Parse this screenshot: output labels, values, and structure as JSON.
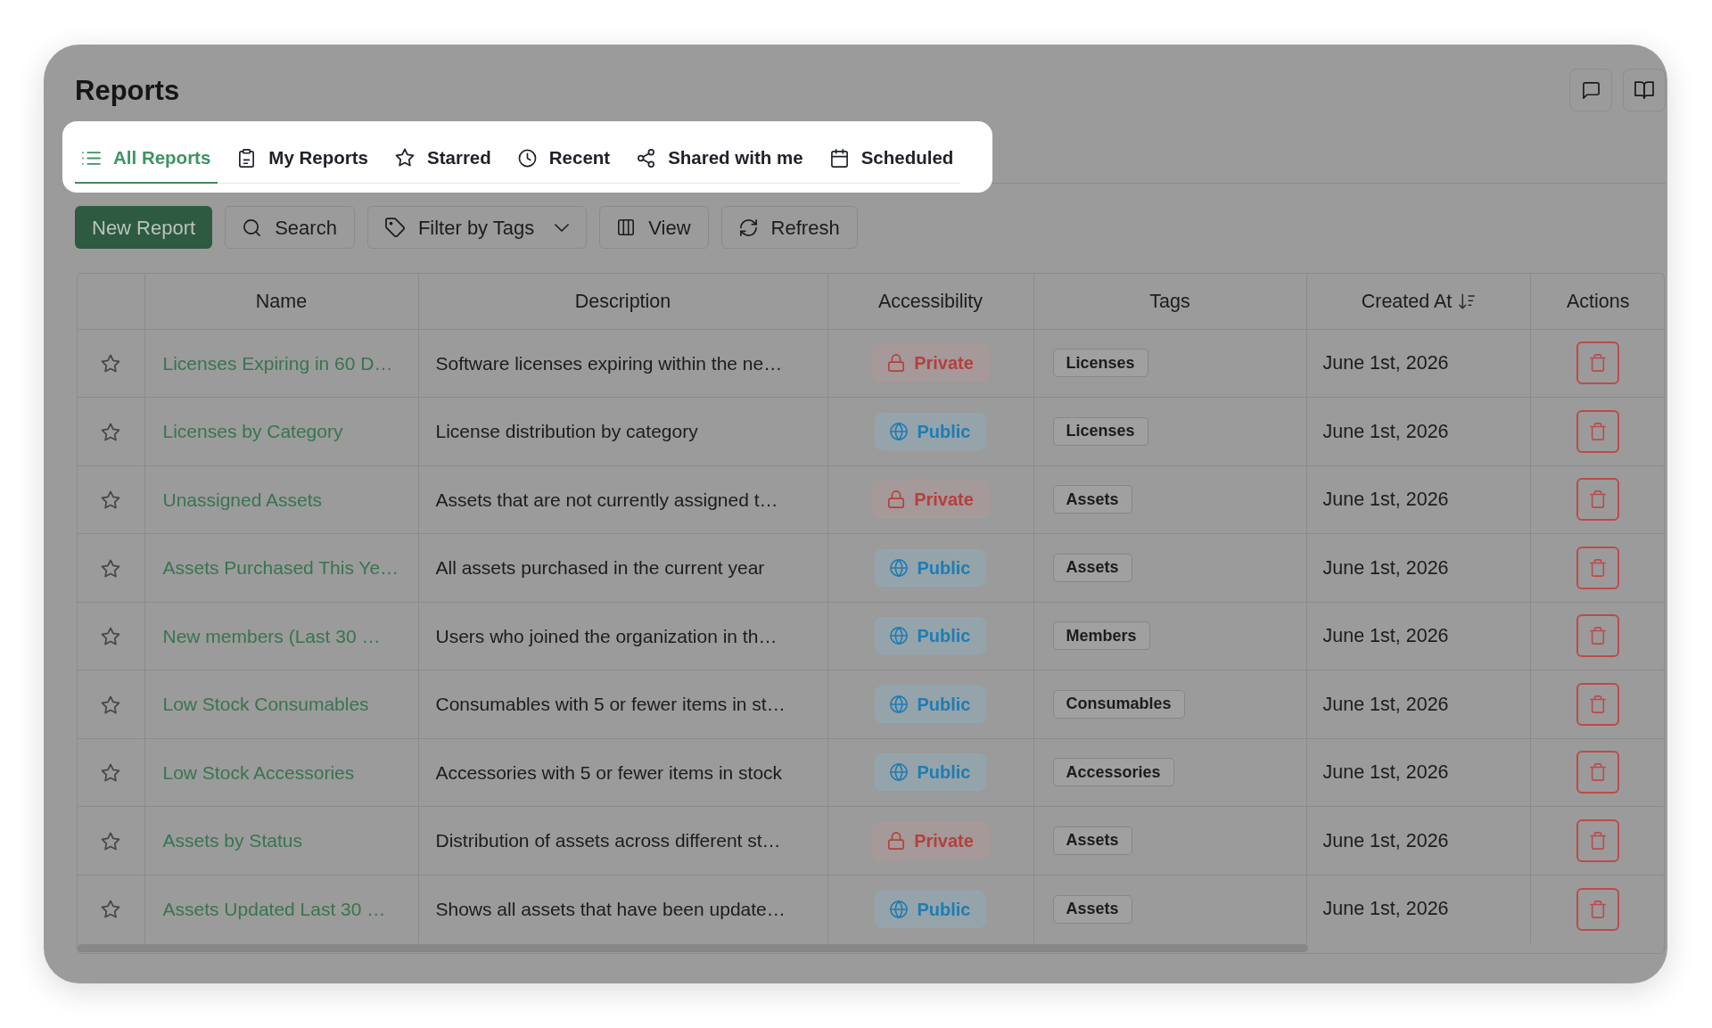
{
  "page": {
    "title": "Reports"
  },
  "tab_bar": {
    "spotlit": true,
    "tabs": [
      {
        "label": "All Reports",
        "selected": true
      },
      {
        "label": "My Reports",
        "selected": false
      },
      {
        "label": "Starred",
        "selected": false
      },
      {
        "label": "Recent",
        "selected": false
      },
      {
        "label": "Shared with me",
        "selected": false
      },
      {
        "label": "Scheduled",
        "selected": false
      }
    ]
  },
  "toolbar": {
    "buttons": [
      {
        "label": "New Report",
        "kind": "primary"
      },
      {
        "label": "Search",
        "kind": "plain"
      },
      {
        "label": "Filter by Tags",
        "kind": "dropdown"
      },
      {
        "label": "View",
        "kind": "plain"
      },
      {
        "label": "Refresh",
        "kind": "plain"
      }
    ]
  },
  "table": {
    "columns": [
      {
        "label": "Name",
        "sorted": false
      },
      {
        "label": "Description",
        "sorted": false
      },
      {
        "label": "Accessibility",
        "sorted": false
      },
      {
        "label": "Tags",
        "sorted": false
      },
      {
        "label": "Created At",
        "sorted": true
      },
      {
        "label": "Actions",
        "sorted": false
      }
    ],
    "rows": [
      {
        "starred": false,
        "name": "Licenses Expiring in 60 D…",
        "description": "Software licenses expiring within the ne…",
        "access": {
          "kind": "private",
          "label": "Private"
        },
        "tags": [
          "Licenses"
        ],
        "created_at": "June 1st, 2026"
      },
      {
        "starred": false,
        "name": "Licenses by Category",
        "description": "License distribution by category",
        "access": {
          "kind": "public",
          "label": "Public"
        },
        "tags": [
          "Licenses"
        ],
        "created_at": "June 1st, 2026"
      },
      {
        "starred": false,
        "name": "Unassigned Assets",
        "description": "Assets that are not currently assigned t…",
        "access": {
          "kind": "private",
          "label": "Private"
        },
        "tags": [
          "Assets"
        ],
        "created_at": "June 1st, 2026"
      },
      {
        "starred": false,
        "name": "Assets Purchased This Ye…",
        "description": "All assets purchased in the current year",
        "access": {
          "kind": "public",
          "label": "Public"
        },
        "tags": [
          "Assets"
        ],
        "created_at": "June 1st, 2026"
      },
      {
        "starred": false,
        "name": "New members (Last 30 …",
        "description": "Users who joined the organization in th…",
        "access": {
          "kind": "public",
          "label": "Public"
        },
        "tags": [
          "Members"
        ],
        "created_at": "June 1st, 2026"
      },
      {
        "starred": false,
        "name": "Low Stock Consumables",
        "description": "Consumables with 5 or fewer items in st…",
        "access": {
          "kind": "public",
          "label": "Public"
        },
        "tags": [
          "Consumables"
        ],
        "created_at": "June 1st, 2026"
      },
      {
        "starred": false,
        "name": "Low Stock Accessories",
        "description": "Accessories with 5 or fewer items in stock",
        "access": {
          "kind": "public",
          "label": "Public"
        },
        "tags": [
          "Accessories"
        ],
        "created_at": "June 1st, 2026"
      },
      {
        "starred": false,
        "name": "Assets by Status",
        "description": "Distribution of assets across different st…",
        "access": {
          "kind": "private",
          "label": "Private"
        },
        "tags": [
          "Assets"
        ],
        "created_at": "June 1st, 2026"
      },
      {
        "starred": false,
        "name": "Assets Updated Last 30 …",
        "description": "Shows all assets that have been update…",
        "access": {
          "kind": "public",
          "label": "Public"
        },
        "tags": [
          "Assets"
        ],
        "created_at": "June 1st, 2026"
      }
    ]
  }
}
